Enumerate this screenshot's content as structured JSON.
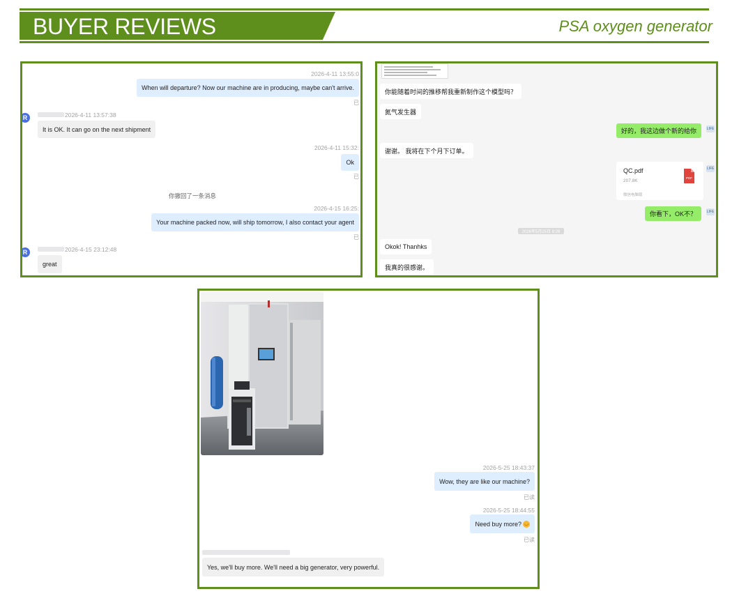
{
  "header": {
    "title": "BUYER REVIEWS",
    "subtitle": "PSA oxygen generator"
  },
  "chat1": {
    "messages": [
      {
        "time": "2026-4-11 13:55:0",
        "text": "When will departure? Now our machine are in producing, maybe can't arrive.",
        "read": "已"
      },
      {
        "sender_avatar": "R",
        "time": "2026-4-11 13:57:38",
        "text": "It is OK. It can go on the next shipment"
      },
      {
        "time": "2026-4-11 15:32:",
        "text": "Ok",
        "read": "已"
      },
      {
        "system": "你撤回了一条消息"
      },
      {
        "time": "2026-4-15 16:25:",
        "text": "Your machine packed now, will ship tomorrow, I also contact your agent",
        "read": "已"
      },
      {
        "sender_avatar": "R",
        "time": "2026-4-15 23:12:48",
        "text": "great"
      }
    ]
  },
  "chat2": {
    "messages": [
      {
        "text": "你能随着时间的推移帮我重新制作这个模型吗？"
      },
      {
        "text": "氮气发生器"
      },
      {
        "text": "好的，我这边做个新的给你"
      },
      {
        "text": "谢谢。 我将在下个月下订单。"
      },
      {
        "file_name": "QC.pdf",
        "file_size": "207.8K",
        "file_source": "微信电脑版",
        "file_type": "PDF"
      },
      {
        "text": "你看下，OK不？"
      },
      {
        "date_separator": "2026年5月25日 9:28"
      },
      {
        "text": "Okok! Thanhks"
      },
      {
        "text": "我真的很感谢。"
      }
    ],
    "avatar_label": "LIFE"
  },
  "chat3": {
    "messages": [
      {
        "time": "2026-5-25 18:43:37",
        "text": "Wow, they are like our machine?",
        "read": "已读"
      },
      {
        "time": "2026-5-25 18:44:55",
        "text": "Need buy more?",
        "emoji": "😏",
        "read": "已读"
      },
      {
        "text": "Yes, we'll buy more. We'll need a big generator, very powerful."
      }
    ]
  },
  "colors": {
    "accent_green": "#5e8e1c",
    "bubble_blue": "#dfeeff",
    "bubble_green": "#95ec69",
    "avatar_blue": "#4a6fe0"
  }
}
